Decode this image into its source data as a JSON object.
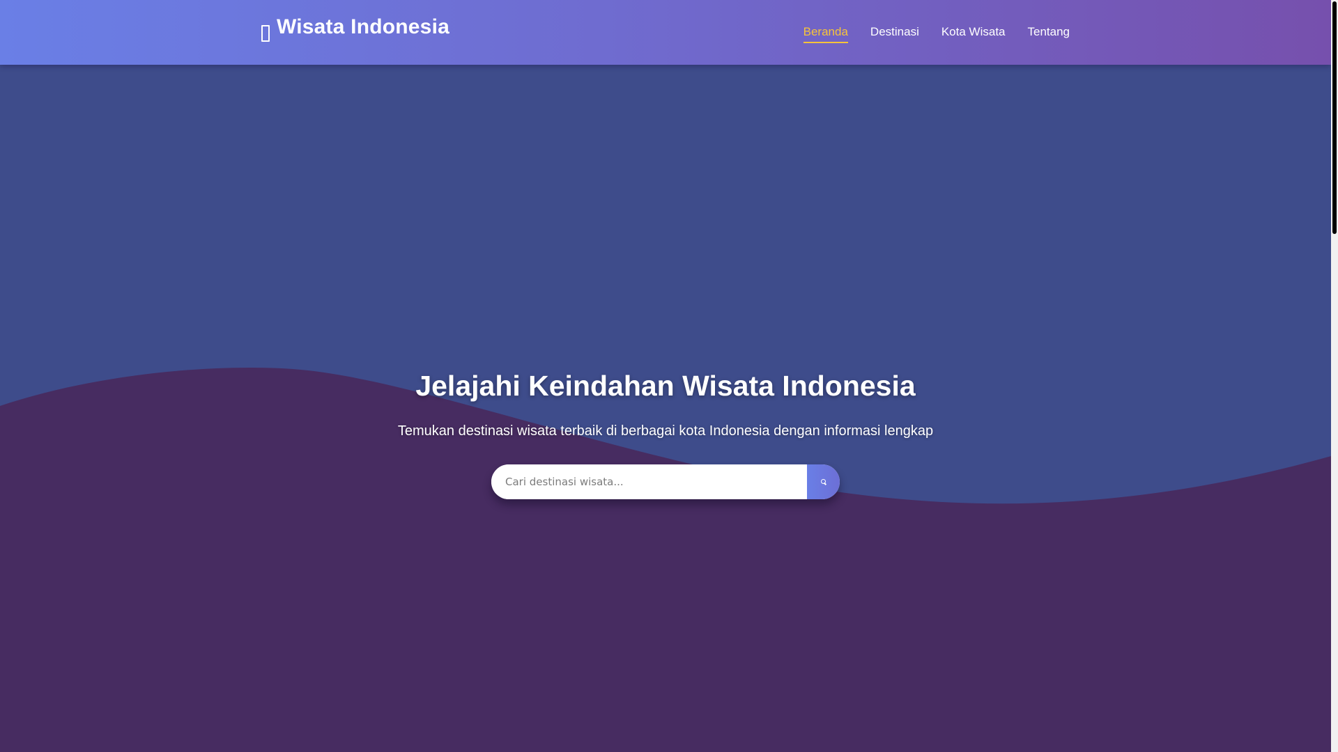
{
  "header": {
    "brand_icon": "map-icon",
    "brand_title": "Wisata Indonesia",
    "nav": [
      {
        "label": "Beranda",
        "active": true
      },
      {
        "label": "Destinasi",
        "active": false
      },
      {
        "label": "Kota Wisata",
        "active": false
      },
      {
        "label": "Tentang",
        "active": false
      }
    ]
  },
  "hero": {
    "title": "Jelajahi Keindahan Wisata Indonesia",
    "subtitle": "Temukan destinasi wisata terbaik di berbagai kota Indonesia dengan informasi lengkap",
    "search": {
      "placeholder": "Cari destinasi wisata...",
      "value": "",
      "button_icon": "search-icon"
    }
  },
  "colors": {
    "accent_active": "#f6c33b",
    "header_start": "#6a7fe6",
    "header_end": "#7650ad",
    "hero_blue": "#3e4c8b",
    "hero_purple": "#472c61"
  }
}
